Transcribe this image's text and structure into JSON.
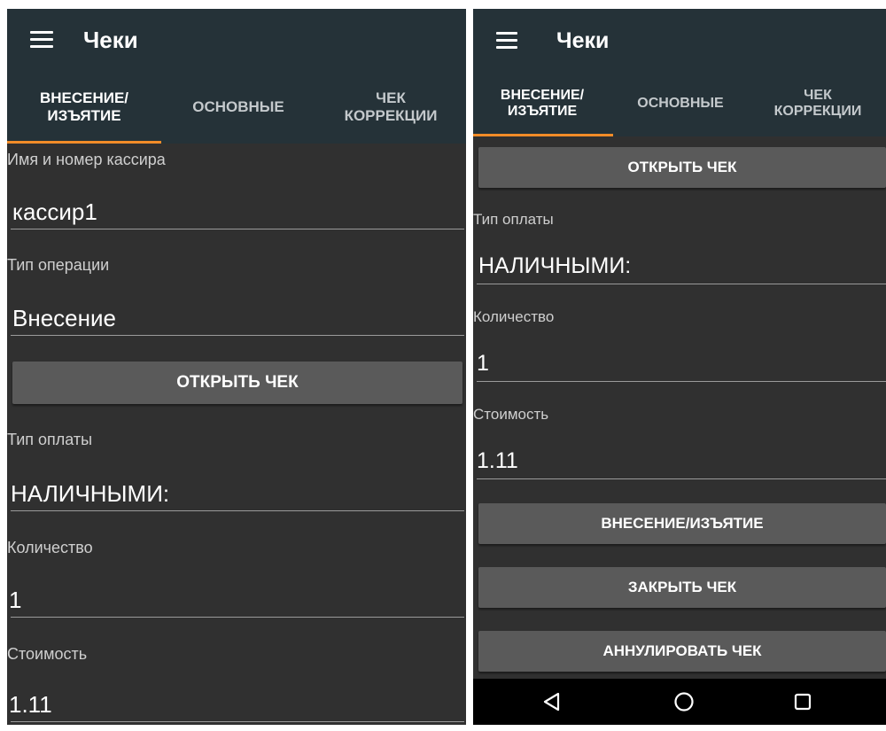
{
  "app_title": "Чеки",
  "tabs": [
    {
      "label": "ВНЕСЕНИЕ/\nИЗЪЯТИЕ",
      "active": true
    },
    {
      "label": "ОСНОВНЫЕ",
      "active": false
    },
    {
      "label": "ЧЕК\nКОРРЕКЦИИ",
      "active": false
    }
  ],
  "form": {
    "cashier_label": "Имя и номер кассира",
    "cashier_value": "кассир1",
    "operation_label": "Тип операции",
    "operation_value": "Внесение",
    "payment_label": "Тип оплаты",
    "payment_value": "НАЛИЧНЫМИ:",
    "quantity_label": "Количество",
    "quantity_value": "1",
    "price_label": "Стоимость",
    "price_value": "1.11"
  },
  "buttons": {
    "open_check": "ОТКРЫТЬ ЧЕК",
    "cash_in_out": "ВНЕСЕНИЕ/ИЗЪЯТИЕ",
    "close_check": "ЗАКРЫТЬ ЧЕК",
    "cancel_check": "АННУЛИРОВАТЬ ЧЕК"
  },
  "nav_icons": [
    "back-icon",
    "home-icon",
    "recents-icon"
  ],
  "colors": {
    "appbar": "#253238",
    "background": "#303030",
    "tab_indicator": "#f28c28",
    "button": "#5a5a5a"
  }
}
